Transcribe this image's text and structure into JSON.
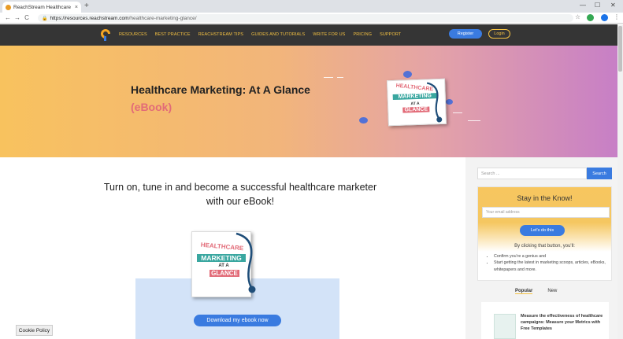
{
  "browser": {
    "tab_title": "ReachStream Healthcare Marketi",
    "tab_close": "×",
    "new_tab": "+",
    "back": "←",
    "forward": "→",
    "reload": "C",
    "lock": "🔒",
    "url_host": "https://resources.reachstream.com",
    "url_path": "/healthcare-marketing-glance/",
    "minimize": "—",
    "maximize": "☐",
    "close": "✕"
  },
  "nav": {
    "links": [
      "RESOURCES",
      "BEST PRACTICE",
      "REACHSTREAM TIPS",
      "GUIDES AND TUTORIALS",
      "WRITE FOR US",
      "PRICING",
      "SUPPORT"
    ],
    "register": "Register",
    "login": "Login"
  },
  "hero": {
    "title": "Healthcare Marketing: At A Glance",
    "subtitle": "(eBook)"
  },
  "book": {
    "line1": "HEALTHCARE",
    "line2": "MARKETING",
    "line3": "AT A",
    "line4": "GLANCE"
  },
  "main": {
    "lead": "Turn on, tune in and become a successful healthcare marketer with our eBook!",
    "download": "Download my ebook now",
    "cookie": "Cookie Policy"
  },
  "sidebar": {
    "search_placeholder": "Search ...",
    "search_button": "Search",
    "stay_title": "Stay in the Know!",
    "email_placeholder": "Your email address",
    "do_it": "Let's do this",
    "clicking": "By clicking that button, you'll:",
    "bullets": [
      "Confirm you're a genius and",
      "Start getting the latest in marketing scoops, articles, eBooks, whitepapers and more."
    ],
    "tab_popular": "Popular",
    "tab_new": "New",
    "card_text": "Measure the effectiveness of healthcare campaigns: Measure your Metrics with Free Templates"
  },
  "colors": {
    "accent": "#3a7be0",
    "nav_bg": "#353535",
    "nav_link": "#f5c242",
    "subtitle": "#e26b78"
  }
}
